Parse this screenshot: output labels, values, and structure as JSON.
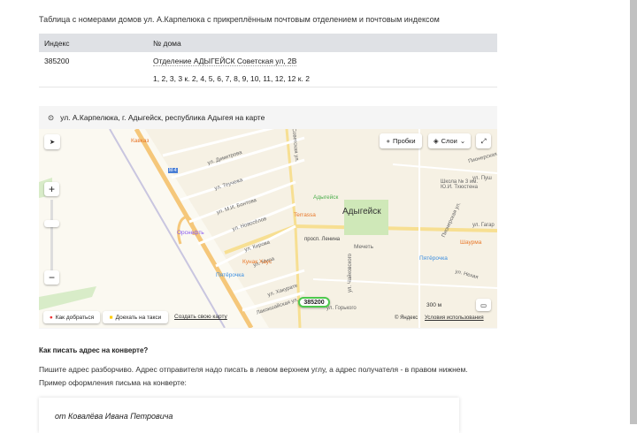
{
  "caption": "Таблица с номерами домов ул. А.Карпелюка с прикреплённым почтовым отделением и почтовым индексом",
  "table": {
    "headers": [
      "Индекс",
      "№ дома"
    ],
    "index": "385200",
    "office": "Отделение АДЫГЕЙСК  Советская ул, 2В",
    "houses": "1, 2, 3, 3 к. 2, 4, 5, 6, 7, 8, 9, 10, 11, 12, 12 к. 2"
  },
  "map": {
    "title": "ул. А.Карпелюка, г. Адыгейск, республика Адыгея на карте",
    "traffic": "Пробки",
    "layers": "Слои",
    "route": "Как добраться",
    "taxi": "Доехать на такси",
    "create": "Создать свою карту",
    "scale": "300 м",
    "copyright": "© Яндекс",
    "terms": "Условия использования",
    "marker": "385200",
    "city": "Адыгейск",
    "streets": [
      "ул. Димитрова",
      "ул. Теучежа",
      "ул. М.И. Бонтова",
      "ул. Новосёлов",
      "ул. Кирова",
      "ул. Мира",
      "ул. Хакурате",
      "Лакокшайская ул.",
      "просп. Ленина",
      "ул. Горького",
      "ул. Чайковского",
      "Пионерская",
      "ул. Пуш",
      "ул. Гагар",
      "ул. Нехая",
      "Пионерская ул.",
      "Советская ул.",
      "М-4"
    ],
    "pois": [
      {
        "name": "Кавказ",
        "color": "#e8782a"
      },
      {
        "name": "Орснефть",
        "color": "#8a5cf0"
      },
      {
        "name": "Terrassa",
        "color": "#e8782a"
      },
      {
        "name": "Адыгейск",
        "color": "#4cae4c"
      },
      {
        "name": "Мечеть",
        "color": "#666666"
      },
      {
        "name": "Кунак Хаус",
        "color": "#e8782a"
      },
      {
        "name": "Пятёрочка",
        "color": "#3d8fe0"
      },
      {
        "name": "Пятёрочка",
        "color": "#3d8fe0"
      },
      {
        "name": "Шаурма",
        "color": "#e8782a"
      },
      {
        "name": "Школа № 3 им. Ю.И. Тхюстена",
        "color": "#666666"
      }
    ]
  },
  "article": {
    "question": "Как писать адрес на конверте?",
    "p1": "Пишите адрес разборчиво. Адрес отправителя надо писать в левом верхнем углу, а адрес получателя - в правом нижнем.",
    "p2": "Пример оформления письма на конверте:",
    "from": "от Ковалёва Ивана Петровича"
  }
}
